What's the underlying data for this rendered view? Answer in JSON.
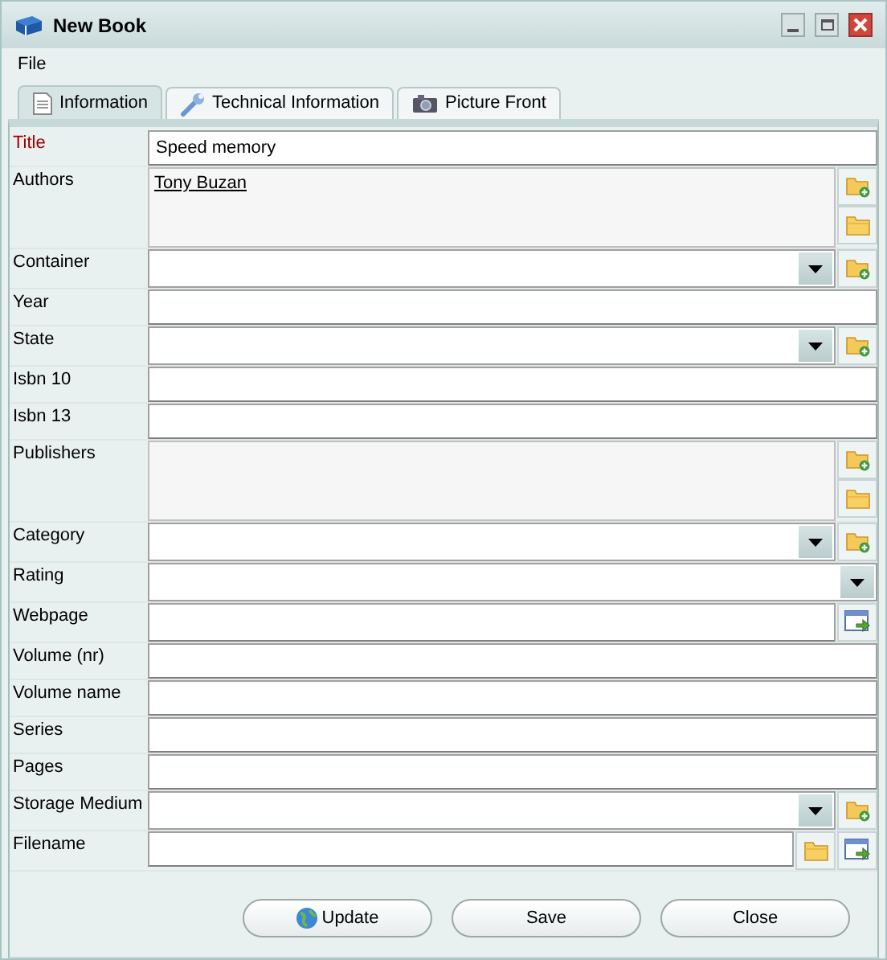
{
  "window": {
    "title": "New Book"
  },
  "menu": [
    "File"
  ],
  "tabs": [
    {
      "label": "Information",
      "selected": true
    },
    {
      "label": "Technical Information",
      "selected": false
    },
    {
      "label": "Picture Front",
      "selected": false
    }
  ],
  "fields": [
    {
      "label": "Title",
      "kind": "text",
      "required": true,
      "value": "Speed memory"
    },
    {
      "label": "Authors",
      "kind": "list",
      "required": false,
      "items": [
        "Tony Buzan"
      ]
    },
    {
      "label": "Container",
      "kind": "dropdown",
      "required": false,
      "add": true
    },
    {
      "label": "Year",
      "kind": "text",
      "required": false
    },
    {
      "label": "State",
      "kind": "dropdown",
      "required": false,
      "add": true
    },
    {
      "label": "Isbn 10",
      "kind": "text",
      "required": false
    },
    {
      "label": "Isbn 13",
      "kind": "text",
      "required": false
    },
    {
      "label": "Publishers",
      "kind": "list",
      "required": false
    },
    {
      "label": "Category",
      "kind": "dropdown",
      "required": false,
      "add": true
    },
    {
      "label": "Rating",
      "kind": "dropdown",
      "required": false,
      "add": false
    },
    {
      "label": "Webpage",
      "kind": "url",
      "required": false
    },
    {
      "label": "Volume (nr)",
      "kind": "text",
      "required": false
    },
    {
      "label": "Volume name",
      "kind": "text",
      "required": false
    },
    {
      "label": "Series",
      "kind": "text",
      "required": false
    },
    {
      "label": "Pages",
      "kind": "text",
      "required": false
    },
    {
      "label": "Storage Medium",
      "kind": "dropdown",
      "required": false,
      "add": true
    },
    {
      "label": "Filename",
      "kind": "file",
      "required": false
    }
  ],
  "buttons": [
    {
      "label": "Update"
    },
    {
      "label": "Save"
    },
    {
      "label": "Close"
    }
  ]
}
